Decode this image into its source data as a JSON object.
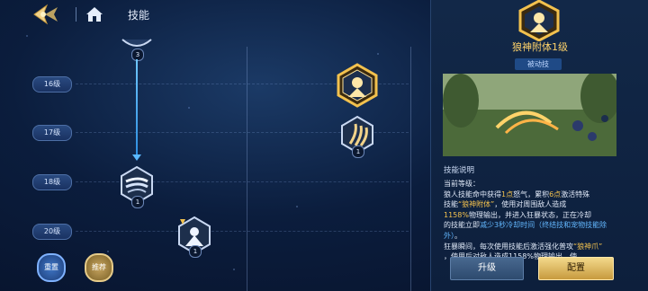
{
  "header": {
    "title": "技能",
    "icons": [
      "back-arrow-icon",
      "home-icon"
    ]
  },
  "levels": [
    "16级",
    "17级",
    "18级",
    "20级"
  ],
  "tree": {
    "skills": [
      {
        "name": "skill-top",
        "count": "3"
      },
      {
        "name": "skill-16",
        "count": ""
      },
      {
        "name": "skill-17",
        "count": "1"
      },
      {
        "name": "skill-18",
        "count": "1"
      },
      {
        "name": "skill-20",
        "count": "1"
      }
    ]
  },
  "buttons": {
    "reset": "重置",
    "recommend": "推荐"
  },
  "panel": {
    "title": "狼神附体1级",
    "tag": "被动技",
    "desc_heading": "技能说明",
    "desc_lines": {
      "l1": "当前等级：",
      "l2a": "狼人技能命中获得",
      "l2b": "1点",
      "l2c": "怒气，累积",
      "l2d": "6点",
      "l2e": "激活特殊",
      "l3a": "技能",
      "l3b": "“狼神附体”",
      "l3c": "，使用对周围敌人造成",
      "l4a": "1158%",
      "l4b": "物理输出，并进入狂暴状态，正在冷却",
      "l5a": "的技能立即",
      "l5b": "减少3秒冷却时间（终结技和宠物技能除外）",
      "l5c": "。",
      "l6a": "狂暴瞬间，每次使用技能后激活强化普攻",
      "l6b": "“狼神爪”",
      "l7": "，使用后对敌人造成1158%物理输出，使"
    },
    "upgrade": "升级",
    "config": "配置"
  },
  "colors": {
    "accent_gold": "#f2c14e",
    "accent_blue": "#63b8ff",
    "bg": "#0b1d3d"
  }
}
